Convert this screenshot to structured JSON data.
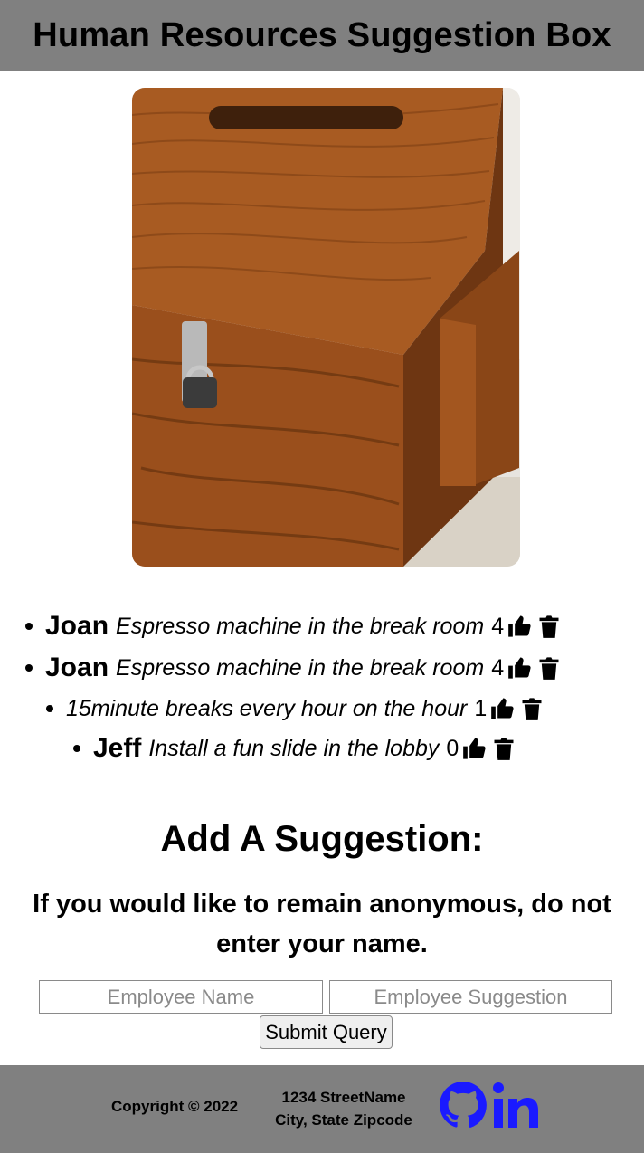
{
  "header": {
    "title": "Human Resources Suggestion Box"
  },
  "photo": {
    "alt": "wooden suggestion box with padlock"
  },
  "suggestions": [
    {
      "name": "Joan",
      "text": "Espresso machine in the break room",
      "votes": "4"
    },
    {
      "name": "Joan",
      "text": "Espresso machine in the break room",
      "votes": "4"
    },
    {
      "name": "",
      "text": "15minute breaks every hour on the hour",
      "votes": "1"
    },
    {
      "name": "Jeff",
      "text": "Install a fun slide in the lobby",
      "votes": "0"
    }
  ],
  "form": {
    "title": "Add A Suggestion:",
    "note": "If you would like to remain anonymous, do not enter your name.",
    "name_placeholder": "Employee Name",
    "suggestion_placeholder": "Employee Suggestion",
    "submit_label": "Submit Query"
  },
  "footer": {
    "copyright": "Copyright © 2022",
    "address_line1": "1234 StreetName",
    "address_line2": "City, State Zipcode",
    "icons": [
      "github-icon",
      "linkedin-icon"
    ],
    "icon_color": "#1a1aff"
  },
  "colors": {
    "header_bg": "#808080",
    "footer_bg": "#808080",
    "accent": "#1a1aff"
  }
}
